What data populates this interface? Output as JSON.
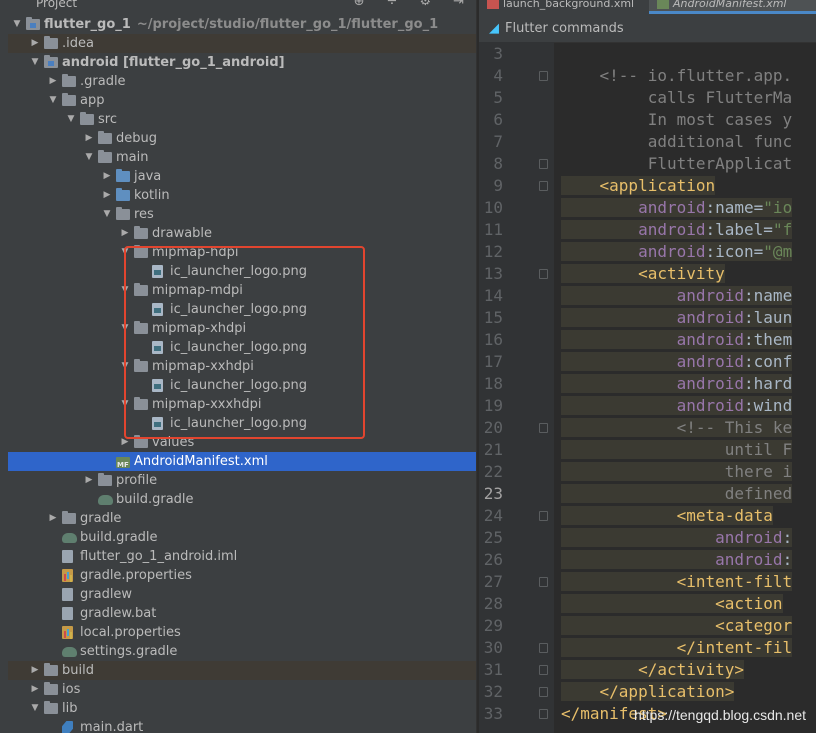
{
  "project_panel": {
    "header_title": "Project",
    "tree": [
      {
        "name": "flutter_go_1",
        "suffix": "~/project/studio/flutter_go_1/flutter_go_1",
        "indent": 0,
        "arrow": "down",
        "icon": "folder-mod",
        "bold": true
      },
      {
        "name": ".idea",
        "indent": 1,
        "arrow": "right",
        "icon": "folder",
        "band": true
      },
      {
        "name": "android [flutter_go_1_android]",
        "indent": 1,
        "arrow": "down",
        "icon": "folder-mod",
        "bold": true
      },
      {
        "name": ".gradle",
        "indent": 2,
        "arrow": "right",
        "icon": "folder"
      },
      {
        "name": "app",
        "indent": 2,
        "arrow": "down",
        "icon": "folder"
      },
      {
        "name": "src",
        "indent": 3,
        "arrow": "down",
        "icon": "folder"
      },
      {
        "name": "debug",
        "indent": 4,
        "arrow": "right",
        "icon": "folder"
      },
      {
        "name": "main",
        "indent": 4,
        "arrow": "down",
        "icon": "folder"
      },
      {
        "name": "java",
        "indent": 5,
        "arrow": "right",
        "icon": "folder-blue"
      },
      {
        "name": "kotlin",
        "indent": 5,
        "arrow": "right",
        "icon": "folder-blue"
      },
      {
        "name": "res",
        "indent": 5,
        "arrow": "down",
        "icon": "folder"
      },
      {
        "name": "drawable",
        "indent": 6,
        "arrow": "right",
        "icon": "folder"
      },
      {
        "name": "mipmap-hdpi",
        "indent": 6,
        "arrow": "down",
        "icon": "folder"
      },
      {
        "name": "ic_launcher_logo.png",
        "indent": 7,
        "arrow": "",
        "icon": "png"
      },
      {
        "name": "mipmap-mdpi",
        "indent": 6,
        "arrow": "down",
        "icon": "folder"
      },
      {
        "name": "ic_launcher_logo.png",
        "indent": 7,
        "arrow": "",
        "icon": "png"
      },
      {
        "name": "mipmap-xhdpi",
        "indent": 6,
        "arrow": "down",
        "icon": "folder"
      },
      {
        "name": "ic_launcher_logo.png",
        "indent": 7,
        "arrow": "",
        "icon": "png"
      },
      {
        "name": "mipmap-xxhdpi",
        "indent": 6,
        "arrow": "down",
        "icon": "folder"
      },
      {
        "name": "ic_launcher_logo.png",
        "indent": 7,
        "arrow": "",
        "icon": "png"
      },
      {
        "name": "mipmap-xxxhdpi",
        "indent": 6,
        "arrow": "down",
        "icon": "folder"
      },
      {
        "name": "ic_launcher_logo.png",
        "indent": 7,
        "arrow": "",
        "icon": "png"
      },
      {
        "name": "values",
        "indent": 6,
        "arrow": "right",
        "icon": "folder"
      },
      {
        "name": "AndroidManifest.xml",
        "indent": 5,
        "arrow": "",
        "icon": "mf",
        "selected": true
      },
      {
        "name": "profile",
        "indent": 4,
        "arrow": "right",
        "icon": "folder"
      },
      {
        "name": "build.gradle",
        "indent": 4,
        "arrow": "",
        "icon": "gradle"
      },
      {
        "name": "gradle",
        "indent": 2,
        "arrow": "right",
        "icon": "folder"
      },
      {
        "name": "build.gradle",
        "indent": 2,
        "arrow": "",
        "icon": "gradle"
      },
      {
        "name": "flutter_go_1_android.iml",
        "indent": 2,
        "arrow": "",
        "icon": "doc"
      },
      {
        "name": "gradle.properties",
        "indent": 2,
        "arrow": "",
        "icon": "bars"
      },
      {
        "name": "gradlew",
        "indent": 2,
        "arrow": "",
        "icon": "doc"
      },
      {
        "name": "gradlew.bat",
        "indent": 2,
        "arrow": "",
        "icon": "doc"
      },
      {
        "name": "local.properties",
        "indent": 2,
        "arrow": "",
        "icon": "bars"
      },
      {
        "name": "settings.gradle",
        "indent": 2,
        "arrow": "",
        "icon": "gradle"
      },
      {
        "name": "build",
        "indent": 1,
        "arrow": "right",
        "icon": "folder",
        "band": true
      },
      {
        "name": "ios",
        "indent": 1,
        "arrow": "right",
        "icon": "folder"
      },
      {
        "name": "lib",
        "indent": 1,
        "arrow": "down",
        "icon": "folder"
      },
      {
        "name": "main.dart",
        "indent": 2,
        "arrow": "",
        "icon": "dart"
      }
    ]
  },
  "editor": {
    "tabs": [
      {
        "label": "launch_background.xml",
        "active": false
      },
      {
        "label": "AndroidManifest.xml",
        "active": true
      }
    ],
    "commands_bar": "Flutter commands",
    "current_line": 23,
    "lines": [
      {
        "n": 3,
        "tokens": []
      },
      {
        "n": 4,
        "fold": true,
        "tokens": [
          {
            "t": "    ",
            "c": "plain"
          },
          {
            "t": "<!-- io.flutter.app.",
            "c": "cmt"
          }
        ]
      },
      {
        "n": 5,
        "tokens": [
          {
            "t": "         calls FlutterMa",
            "c": "cmt"
          }
        ]
      },
      {
        "n": 6,
        "tokens": [
          {
            "t": "         In most cases y",
            "c": "cmt"
          }
        ]
      },
      {
        "n": 7,
        "tokens": [
          {
            "t": "         additional func",
            "c": "cmt"
          }
        ]
      },
      {
        "n": 8,
        "fold": true,
        "tokens": [
          {
            "t": "         FlutterApplicat",
            "c": "cmt"
          }
        ]
      },
      {
        "n": 9,
        "fold": true,
        "hl": true,
        "tokens": [
          {
            "t": "    ",
            "c": "plain"
          },
          {
            "t": "<application",
            "c": "tag"
          }
        ]
      },
      {
        "n": 10,
        "hl": true,
        "tokens": [
          {
            "t": "        ",
            "c": "plain"
          },
          {
            "t": "android",
            "c": "attr"
          },
          {
            "t": ":name=",
            "c": "plain"
          },
          {
            "t": "\"io",
            "c": "val"
          }
        ]
      },
      {
        "n": 11,
        "hl": true,
        "tokens": [
          {
            "t": "        ",
            "c": "plain"
          },
          {
            "t": "android",
            "c": "attr"
          },
          {
            "t": ":label=",
            "c": "plain"
          },
          {
            "t": "\"f",
            "c": "val"
          }
        ]
      },
      {
        "n": 12,
        "hl": true,
        "tokens": [
          {
            "t": "        ",
            "c": "plain"
          },
          {
            "t": "android",
            "c": "attr"
          },
          {
            "t": ":icon=",
            "c": "plain"
          },
          {
            "t": "\"@m",
            "c": "val"
          }
        ]
      },
      {
        "n": 13,
        "fold": true,
        "hl": true,
        "tokens": [
          {
            "t": "        ",
            "c": "plain"
          },
          {
            "t": "<activity",
            "c": "tag"
          }
        ]
      },
      {
        "n": 14,
        "hl": true,
        "tokens": [
          {
            "t": "            ",
            "c": "plain"
          },
          {
            "t": "android",
            "c": "attr"
          },
          {
            "t": ":name",
            "c": "plain"
          }
        ]
      },
      {
        "n": 15,
        "hl": true,
        "tokens": [
          {
            "t": "            ",
            "c": "plain"
          },
          {
            "t": "android",
            "c": "attr"
          },
          {
            "t": ":laun",
            "c": "plain"
          }
        ]
      },
      {
        "n": 16,
        "hl": true,
        "tokens": [
          {
            "t": "            ",
            "c": "plain"
          },
          {
            "t": "android",
            "c": "attr"
          },
          {
            "t": ":them",
            "c": "plain"
          }
        ]
      },
      {
        "n": 17,
        "hl": true,
        "tokens": [
          {
            "t": "            ",
            "c": "plain"
          },
          {
            "t": "android",
            "c": "attr"
          },
          {
            "t": ":conf",
            "c": "plain"
          }
        ]
      },
      {
        "n": 18,
        "hl": true,
        "tokens": [
          {
            "t": "            ",
            "c": "plain"
          },
          {
            "t": "android",
            "c": "attr"
          },
          {
            "t": ":hard",
            "c": "plain"
          }
        ]
      },
      {
        "n": 19,
        "hl": true,
        "tokens": [
          {
            "t": "            ",
            "c": "plain"
          },
          {
            "t": "android",
            "c": "attr"
          },
          {
            "t": ":wind",
            "c": "plain"
          }
        ]
      },
      {
        "n": 20,
        "fold": true,
        "hl": true,
        "tokens": [
          {
            "t": "            ",
            "c": "plain"
          },
          {
            "t": "<!-- This ke",
            "c": "cmt"
          }
        ]
      },
      {
        "n": 21,
        "hl": true,
        "tokens": [
          {
            "t": "                 until F",
            "c": "cmt"
          }
        ]
      },
      {
        "n": 22,
        "hl": true,
        "tokens": [
          {
            "t": "                 there i",
            "c": "cmt"
          }
        ]
      },
      {
        "n": 23,
        "hl": true,
        "tokens": [
          {
            "t": "                 defined",
            "c": "cmt"
          }
        ]
      },
      {
        "n": 24,
        "fold": true,
        "hl": true,
        "tokens": [
          {
            "t": "            ",
            "c": "plain"
          },
          {
            "t": "<meta-data",
            "c": "tag"
          }
        ]
      },
      {
        "n": 25,
        "hl": true,
        "tokens": [
          {
            "t": "                ",
            "c": "plain"
          },
          {
            "t": "android",
            "c": "attr"
          },
          {
            "t": ":",
            "c": "plain"
          }
        ]
      },
      {
        "n": 26,
        "hl": true,
        "tokens": [
          {
            "t": "                ",
            "c": "plain"
          },
          {
            "t": "android",
            "c": "attr"
          },
          {
            "t": ":",
            "c": "plain"
          }
        ]
      },
      {
        "n": 27,
        "fold": true,
        "hl": true,
        "tokens": [
          {
            "t": "            ",
            "c": "plain"
          },
          {
            "t": "<intent-filt",
            "c": "tag"
          }
        ]
      },
      {
        "n": 28,
        "hl": true,
        "tokens": [
          {
            "t": "                ",
            "c": "plain"
          },
          {
            "t": "<action",
            "c": "tag"
          }
        ]
      },
      {
        "n": 29,
        "hl": true,
        "tokens": [
          {
            "t": "                ",
            "c": "plain"
          },
          {
            "t": "<categor",
            "c": "tag"
          }
        ]
      },
      {
        "n": 30,
        "fold": true,
        "hl": true,
        "tokens": [
          {
            "t": "            ",
            "c": "plain"
          },
          {
            "t": "</intent-fil",
            "c": "tag"
          }
        ]
      },
      {
        "n": 31,
        "fold": true,
        "hl": true,
        "tokens": [
          {
            "t": "        ",
            "c": "plain"
          },
          {
            "t": "</activity>",
            "c": "tag"
          }
        ]
      },
      {
        "n": 32,
        "fold": true,
        "hl": true,
        "tokens": [
          {
            "t": "    ",
            "c": "plain"
          },
          {
            "t": "</application>",
            "c": "tag"
          }
        ]
      },
      {
        "n": 33,
        "fold": true,
        "tokens": [
          {
            "t": "</manifest>",
            "c": "tag"
          }
        ]
      }
    ]
  },
  "watermark": "https://tengqd.blog.csdn.net"
}
